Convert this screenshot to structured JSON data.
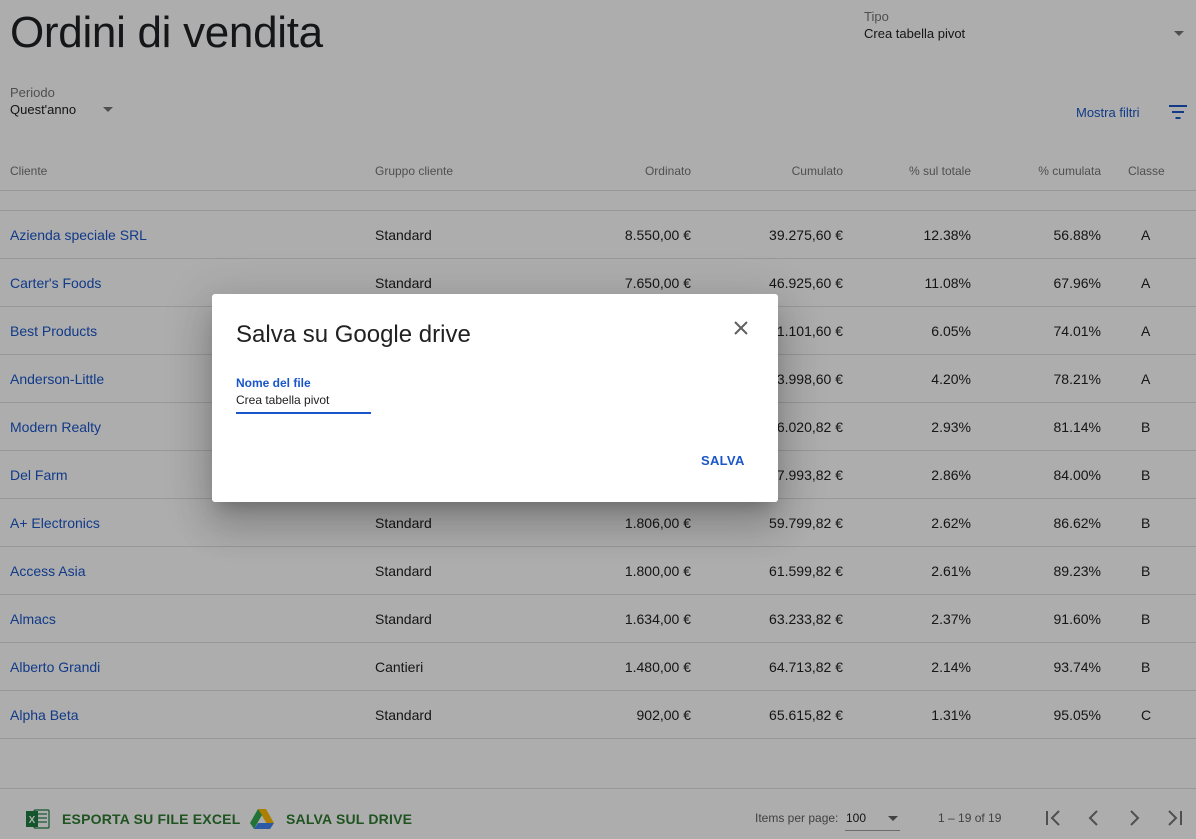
{
  "page": {
    "title": "Ordini di vendita"
  },
  "tipo": {
    "label": "Tipo",
    "value": "Crea tabella pivot"
  },
  "periodo": {
    "label": "Periodo",
    "value": "Quest'anno"
  },
  "filters": {
    "show_label": "Mostra filtri"
  },
  "table": {
    "columns": {
      "cliente": "Cliente",
      "gruppo": "Gruppo cliente",
      "ordinato": "Ordinato",
      "cumulato": "Cumulato",
      "pct_totale": "% sul totale",
      "pct_cumulata": "% cumulata",
      "classe": "Classe"
    },
    "rows": [
      {
        "cliente": "Azienda speciale SRL",
        "gruppo": "Standard",
        "ordinato": "8.550,00 €",
        "cumulato": "39.275,60 €",
        "pct_totale": "12.38%",
        "pct_cumulata": "56.88%",
        "classe": "A"
      },
      {
        "cliente": "Carter's Foods",
        "gruppo": "Standard",
        "ordinato": "7.650,00 €",
        "cumulato": "46.925,60 €",
        "pct_totale": "11.08%",
        "pct_cumulata": "67.96%",
        "classe": "A"
      },
      {
        "cliente": "Best Products",
        "gruppo": "",
        "ordinato": "",
        "cumulato": "1.101,60 €",
        "pct_totale": "6.05%",
        "pct_cumulata": "74.01%",
        "classe": "A"
      },
      {
        "cliente": "Anderson-Little",
        "gruppo": "",
        "ordinato": "",
        "cumulato": "3.998,60 €",
        "pct_totale": "4.20%",
        "pct_cumulata": "78.21%",
        "classe": "A"
      },
      {
        "cliente": "Modern Realty",
        "gruppo": "",
        "ordinato": "",
        "cumulato": "6.020,82 €",
        "pct_totale": "2.93%",
        "pct_cumulata": "81.14%",
        "classe": "B"
      },
      {
        "cliente": "Del Farm",
        "gruppo": "",
        "ordinato": "",
        "cumulato": "7.993,82 €",
        "pct_totale": "2.86%",
        "pct_cumulata": "84.00%",
        "classe": "B"
      },
      {
        "cliente": "A+ Electronics",
        "gruppo": "Standard",
        "ordinato": "1.806,00 €",
        "cumulato": "59.799,82 €",
        "pct_totale": "2.62%",
        "pct_cumulata": "86.62%",
        "classe": "B"
      },
      {
        "cliente": "Access Asia",
        "gruppo": "Standard",
        "ordinato": "1.800,00 €",
        "cumulato": "61.599,82 €",
        "pct_totale": "2.61%",
        "pct_cumulata": "89.23%",
        "classe": "B"
      },
      {
        "cliente": "Almacs",
        "gruppo": "Standard",
        "ordinato": "1.634,00 €",
        "cumulato": "63.233,82 €",
        "pct_totale": "2.37%",
        "pct_cumulata": "91.60%",
        "classe": "B"
      },
      {
        "cliente": "Alberto Grandi",
        "gruppo": "Cantieri",
        "ordinato": "1.480,00 €",
        "cumulato": "64.713,82 €",
        "pct_totale": "2.14%",
        "pct_cumulata": "93.74%",
        "classe": "B"
      },
      {
        "cliente": "Alpha Beta",
        "gruppo": "Standard",
        "ordinato": "902,00 €",
        "cumulato": "65.615,82 €",
        "pct_totale": "1.31%",
        "pct_cumulata": "95.05%",
        "classe": "C"
      }
    ]
  },
  "footer": {
    "export_excel_label": "ESPORTA SU FILE EXCEL",
    "save_drive_label": "SALVA SUL DRIVE",
    "items_per_page_label": "Items per page:",
    "items_per_page_value": "100",
    "range_label": "1 – 19 of 19"
  },
  "dialog": {
    "title": "Salva su Google drive",
    "field_label": "Nome del file",
    "field_value": "Crea tabella pivot",
    "save_label": "SALVA"
  },
  "colors": {
    "link": "#1a56c9",
    "action_green": "#2e7d32",
    "overlay": "rgba(0,0,0,0.32)"
  },
  "icons": {
    "filter": "filter-list-icon",
    "excel": "excel-icon",
    "drive": "google-drive-icon",
    "close": "close-icon",
    "first_page": "first-page-icon",
    "prev_page": "chevron-left-icon",
    "next_page": "chevron-right-icon",
    "last_page": "last-page-icon"
  }
}
